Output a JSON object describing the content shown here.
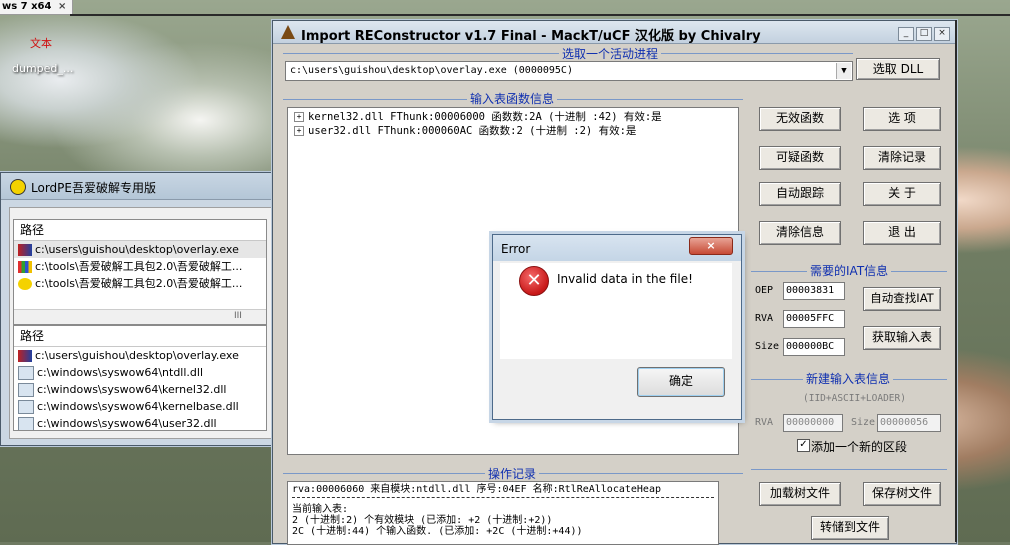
{
  "desktop": {
    "taskbar_text": "ws 7 x64",
    "taskbar_close": "×",
    "red_label": "文本",
    "dumped_label": "dumped_..."
  },
  "lordpe": {
    "title": "LordPE吾爱破解专用版",
    "list1_header": "路径",
    "list1_rows": [
      "c:\\users\\guishou\\desktop\\overlay.exe",
      "c:\\tools\\吾爱破解工具包2.0\\吾爱破解工...",
      "c:\\tools\\吾爱破解工具包2.0\\吾爱破解工..."
    ],
    "list1_scroll": "III",
    "list2_header": "路径",
    "list2_rows": [
      "c:\\users\\guishou\\desktop\\overlay.exe",
      "c:\\windows\\syswow64\\ntdll.dll",
      "c:\\windows\\syswow64\\kernel32.dll",
      "c:\\windows\\syswow64\\kernelbase.dll",
      "c:\\windows\\syswow64\\user32.dll"
    ]
  },
  "importrec": {
    "title": "Import REConstructor v1.7 Final - MackT/uCF 汉化版 by Chivalry",
    "win_buttons": [
      "_",
      "□",
      "×"
    ],
    "group_process": "选取一个活动进程",
    "process_value": "c:\\users\\guishou\\desktop\\overlay.exe (0000095C)",
    "btn_pick_dll": "选取 DLL",
    "group_iat_info": "输入表函数信息",
    "tree_rows": [
      "kernel32.dll FThunk:00006000 函数数:2A (十进制 :42) 有效:是",
      "user32.dll FThunk:000060AC 函数数:2 (十进制 :2) 有效:是"
    ],
    "btn_invalid": "无效函数",
    "btn_options": "选   项",
    "btn_suspect": "可疑函数",
    "btn_clear_log": "清除记录",
    "btn_auto_trace": "自动跟踪",
    "btn_about": "关   于",
    "btn_clear_info": "清除信息",
    "btn_exit": "退   出",
    "group_needed_iat": "需要的IAT信息",
    "oep_label": "OEP",
    "oep_value": "00003831",
    "rva_label": "RVA",
    "rva_value": "00005FFC",
    "size_label": "Size",
    "size_value": "000000BC",
    "btn_auto_iat": "自动查找IAT",
    "btn_get_imports": "获取输入表",
    "group_new_iat": "新建输入表信息",
    "new_iat_hint": "(IID+ASCII+LOADER)",
    "new_rva_label": "RVA",
    "new_rva_value": "00000000",
    "new_size_label": "Size",
    "new_size_value": "00000056",
    "add_section_label": "添加一个新的区段",
    "add_section_checked": true,
    "group_log": "操作记录",
    "log_lines": [
      "rva:00006060 来自模块:ntdll.dll 序号:04EF 名称:RtlReAllocateHeap",
      "当前输入表:",
      "2 (十进制:2) 个有效模块 (已添加: +2 (十进制:+2))",
      "2C (十进制:44) 个输入函数. (已添加: +2C (十进制:+44))"
    ],
    "btn_load_tree": "加载树文件",
    "btn_save_tree": "保存树文件",
    "btn_dump_to_file": "转储到文件"
  },
  "error_dialog": {
    "title": "Error",
    "close": "×",
    "icon": "error-icon",
    "icon_glyph": "✕",
    "message": "Invalid data in the file!",
    "ok": "确定"
  }
}
